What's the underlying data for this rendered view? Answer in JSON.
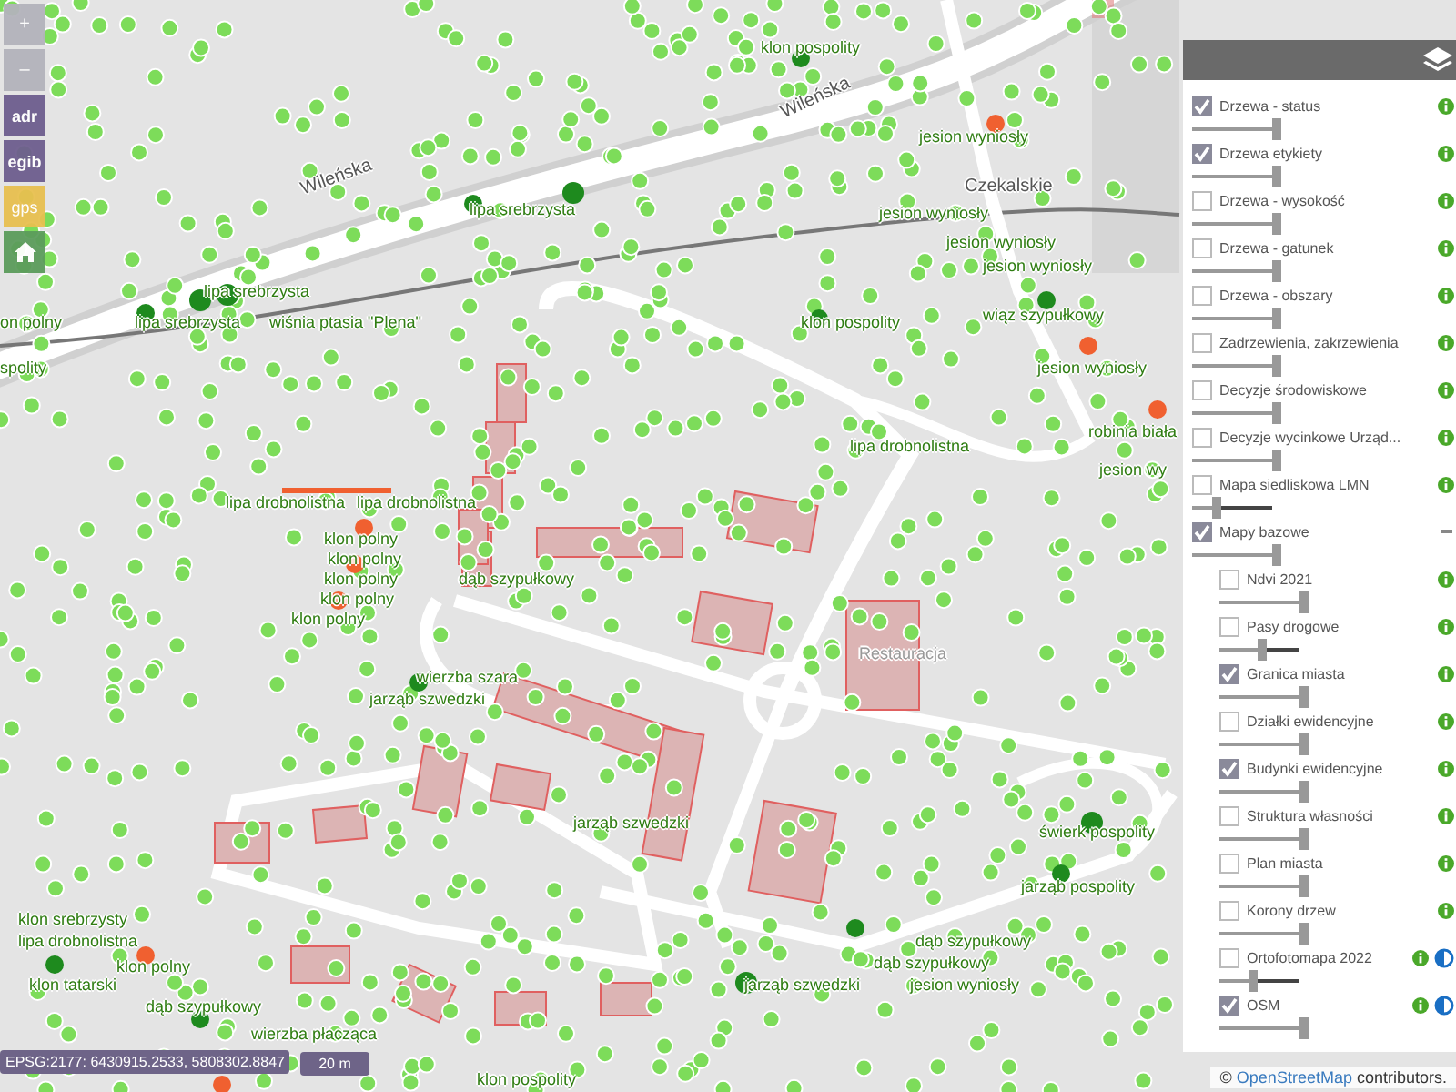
{
  "toolbar": {
    "buttons": [
      {
        "kind": "zoom",
        "label": "+"
      },
      {
        "kind": "zoom",
        "label": "–"
      },
      {
        "kind": "search",
        "label": "adr"
      },
      {
        "kind": "search",
        "label": "egib"
      },
      {
        "kind": "gps",
        "label": "gps"
      },
      {
        "kind": "home"
      }
    ]
  },
  "map": {
    "labels": [
      {
        "kind": "tree",
        "text": "klon pospolity"
      },
      {
        "kind": "street",
        "text": "Wileńska"
      },
      {
        "kind": "tree",
        "text": "jesion wyniosły"
      },
      {
        "kind": "street",
        "text": "Wileńska"
      },
      {
        "kind": "street",
        "text": "Czekalskie"
      },
      {
        "kind": "tree",
        "text": "lipa srebrzysta"
      },
      {
        "kind": "tree",
        "text": "jesion wyniosły"
      },
      {
        "kind": "tree",
        "text": "jesion wyniosły"
      },
      {
        "kind": "tree",
        "text": "jesion wyniosły"
      },
      {
        "kind": "tree",
        "text": "lipa srebrzysta"
      },
      {
        "kind": "tree",
        "text": "on polny"
      },
      {
        "kind": "tree",
        "text": "lipa srebrzysta"
      },
      {
        "kind": "tree",
        "text": "wiśnia ptasia \"Plena\""
      },
      {
        "kind": "tree",
        "text": "klon pospolity"
      },
      {
        "kind": "tree",
        "text": "wiąz szypułkowy"
      },
      {
        "kind": "tree",
        "text": "spolity"
      },
      {
        "kind": "tree",
        "text": "jesion wyniosły"
      },
      {
        "kind": "tree",
        "text": "robinia biała"
      },
      {
        "kind": "tree",
        "text": "lipa drobnolistna"
      },
      {
        "kind": "tree",
        "text": "jesion wy"
      },
      {
        "kind": "tree",
        "text": "lipa drobnolistna"
      },
      {
        "kind": "tree",
        "text": "lipa drobnolistna"
      },
      {
        "kind": "tree",
        "text": "klon polny"
      },
      {
        "kind": "tree",
        "text": "klon polny"
      },
      {
        "kind": "tree",
        "text": "klon polny"
      },
      {
        "kind": "tree",
        "text": "dąb szypułkowy"
      },
      {
        "kind": "tree",
        "text": "klon polny"
      },
      {
        "kind": "tree",
        "text": "klon polny"
      },
      {
        "kind": "place",
        "text": "Restauracja"
      },
      {
        "kind": "tree",
        "text": "wierzba szara"
      },
      {
        "kind": "tree",
        "text": "jarząb szwedzki"
      },
      {
        "kind": "tree",
        "text": "jarząb szwedzki"
      },
      {
        "kind": "tree",
        "text": "świerk pospolity"
      },
      {
        "kind": "tree",
        "text": "jarząb pospolity"
      },
      {
        "kind": "tree",
        "text": "klon srebrzysty"
      },
      {
        "kind": "tree",
        "text": "lipa drobnolistna"
      },
      {
        "kind": "tree",
        "text": "dąb szypułkowy"
      },
      {
        "kind": "tree",
        "text": "klon polny"
      },
      {
        "kind": "tree",
        "text": "dąb szypułkowy"
      },
      {
        "kind": "tree",
        "text": "klon tatarski"
      },
      {
        "kind": "tree",
        "text": "jarząb szwedzki"
      },
      {
        "kind": "tree",
        "text": "jesion wyniosły"
      },
      {
        "kind": "tree",
        "text": "dąb szypułkowy"
      },
      {
        "kind": "tree",
        "text": "wierzba płacząca"
      },
      {
        "kind": "tree",
        "text": "klon pospolity"
      }
    ],
    "attribution": {
      "prefix": "©",
      "link": "OpenStreetMap",
      "suffix": "contributors."
    }
  },
  "status": {
    "coordinates": "EPSG:2177: 6430915.2533, 5808302.8847",
    "scale": "20 m"
  },
  "layers": {
    "items": [
      {
        "kind": "layer",
        "label": "Drzewa - status",
        "checked": true,
        "level": 1,
        "info": true
      },
      {
        "kind": "layer",
        "label": "Drzewa etykiety",
        "checked": true,
        "level": 1,
        "info": true
      },
      {
        "kind": "layer",
        "label": "Drzewa - wysokość",
        "checked": false,
        "level": 1,
        "info": true
      },
      {
        "kind": "layer",
        "label": "Drzewa - gatunek",
        "checked": false,
        "level": 1,
        "info": true
      },
      {
        "kind": "layer",
        "label": "Drzewa - obszary",
        "checked": false,
        "level": 1,
        "info": true
      },
      {
        "kind": "layer",
        "label": "Zadrzewienia, zakrzewienia",
        "checked": false,
        "level": 1,
        "info": true
      },
      {
        "kind": "layer",
        "label": "Decyzje środowiskowe",
        "checked": false,
        "level": 1,
        "info": true
      },
      {
        "kind": "layer",
        "label": "Decyzje wycinkowe Urząd...",
        "checked": false,
        "level": 1,
        "info": true
      },
      {
        "kind": "layer",
        "label": "Mapa siedliskowa LMN",
        "checked": false,
        "level": 0.3,
        "info": true
      },
      {
        "kind": "group",
        "label": "Mapy bazowe",
        "checked": true,
        "level": 1,
        "children": [
          {
            "kind": "layer",
            "label": "Ndvi 2021",
            "checked": false,
            "level": 1,
            "info": true
          },
          {
            "kind": "layer",
            "label": "Pasy drogowe",
            "checked": false,
            "level": 0.5,
            "info": true
          },
          {
            "kind": "layer",
            "label": "Granica miasta",
            "checked": true,
            "level": 1,
            "info": true
          },
          {
            "kind": "layer",
            "label": "Działki ewidencyjne",
            "checked": false,
            "level": 1,
            "info": true
          },
          {
            "kind": "layer",
            "label": "Budynki ewidencyjne",
            "checked": true,
            "level": 1,
            "info": true
          },
          {
            "kind": "layer",
            "label": "Struktura własności",
            "checked": false,
            "level": 1,
            "info": true
          },
          {
            "kind": "layer",
            "label": "Plan miasta",
            "checked": false,
            "level": 1,
            "info": true
          },
          {
            "kind": "layer",
            "label": "Korony drzew",
            "checked": false,
            "level": 1,
            "info": true
          },
          {
            "kind": "layer",
            "label": "Ortofotomapa 2022",
            "checked": false,
            "level": 0.4,
            "info": true,
            "contrast": true
          },
          {
            "kind": "layer",
            "label": "OSM",
            "checked": true,
            "level": 1,
            "info": true,
            "contrast": true
          }
        ]
      }
    ]
  }
}
